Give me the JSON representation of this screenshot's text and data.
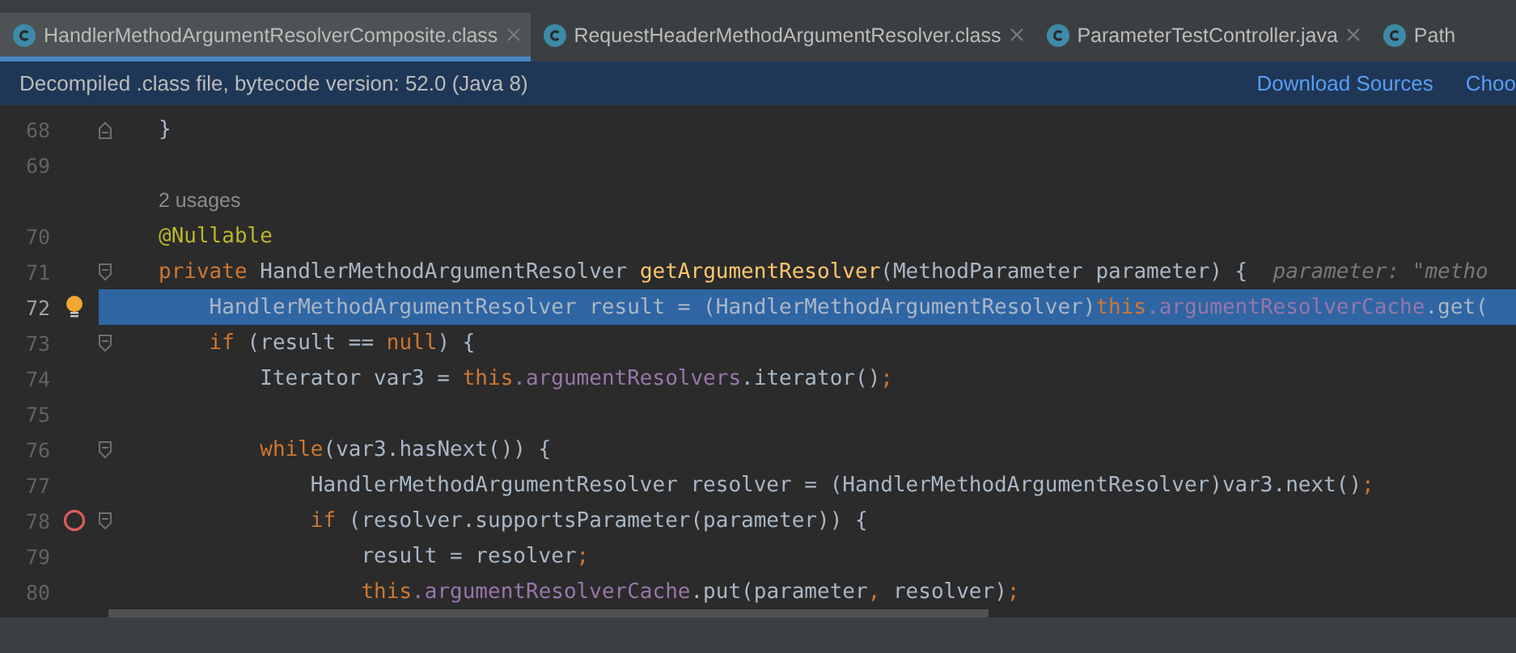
{
  "tabs": [
    {
      "label": "HandlerMethodArgumentResolverComposite.class",
      "selected": true,
      "closable": true
    },
    {
      "label": "RequestHeaderMethodArgumentResolver.class",
      "selected": false,
      "closable": true
    },
    {
      "label": "ParameterTestController.java",
      "selected": false,
      "closable": true
    },
    {
      "label": "Path",
      "selected": false,
      "closable": false
    }
  ],
  "banner": {
    "message": "Decompiled .class file, bytecode version: 52.0 (Java 8)",
    "links": [
      "Download Sources",
      "Choo"
    ]
  },
  "editor": {
    "lines": [
      {
        "kind": "code",
        "number": "68",
        "selected": false,
        "fold": {
          "kind": "end"
        },
        "tokens": [
          {
            "kind": "plain",
            "s": "}"
          }
        ]
      },
      {
        "kind": "code",
        "number": "69",
        "selected": false
      },
      {
        "kind": "usages",
        "text": "2 usages"
      },
      {
        "kind": "code",
        "number": "70",
        "selected": false,
        "tokens": [
          {
            "kind": "annotation",
            "s": "@Nullable"
          }
        ]
      },
      {
        "kind": "code",
        "number": "71",
        "selected": false,
        "fold": {
          "kind": "start"
        },
        "tokens": [
          {
            "kind": "kw",
            "s": "private "
          },
          {
            "kind": "plain",
            "s": "HandlerMethodArgumentResolver "
          },
          {
            "kind": "method",
            "s": "getArgumentResolver"
          },
          {
            "kind": "plain",
            "s": "(MethodParameter parameter) {  "
          },
          {
            "kind": "hint",
            "s": "parameter: \"metho"
          }
        ]
      },
      {
        "kind": "code",
        "number": "72",
        "selected": true,
        "gutter_icon": {
          "kind": "bulb"
        },
        "tokens": [
          {
            "kind": "plain",
            "s": "    HandlerMethodArgumentResolver result = (HandlerMethodArgumentResolver)"
          },
          {
            "kind": "kw",
            "s": "this"
          },
          {
            "kind": "field",
            "s": ".argumentResolverCache"
          },
          {
            "kind": "plain",
            "s": ".get("
          }
        ]
      },
      {
        "kind": "code",
        "number": "73",
        "selected": false,
        "fold": {
          "kind": "start"
        },
        "tokens": [
          {
            "kind": "kw",
            "s": "    if "
          },
          {
            "kind": "plain",
            "s": "(result == "
          },
          {
            "kind": "kw",
            "s": "null"
          },
          {
            "kind": "plain",
            "s": ") {"
          }
        ]
      },
      {
        "kind": "code",
        "number": "74",
        "selected": false,
        "tokens": [
          {
            "kind": "plain",
            "s": "        Iterator var3 = "
          },
          {
            "kind": "kw",
            "s": "this"
          },
          {
            "kind": "field",
            "s": ".argumentResolvers"
          },
          {
            "kind": "plain",
            "s": ".iterator()"
          },
          {
            "kind": "kw",
            "s": ";"
          }
        ]
      },
      {
        "kind": "code",
        "number": "75",
        "selected": false
      },
      {
        "kind": "code",
        "number": "76",
        "selected": false,
        "fold": {
          "kind": "start"
        },
        "tokens": [
          {
            "kind": "kw",
            "s": "        while"
          },
          {
            "kind": "plain",
            "s": "(var3.hasNext()) {"
          }
        ]
      },
      {
        "kind": "code",
        "number": "77",
        "selected": false,
        "tokens": [
          {
            "kind": "plain",
            "s": "            HandlerMethodArgumentResolver resolver = (HandlerMethodArgumentResolver)var3.next()"
          },
          {
            "kind": "kw",
            "s": ";"
          }
        ]
      },
      {
        "kind": "code",
        "number": "78",
        "selected": false,
        "gutter_icon": {
          "kind": "breakpoint"
        },
        "fold": {
          "kind": "start"
        },
        "tokens": [
          {
            "kind": "kw",
            "s": "            if "
          },
          {
            "kind": "plain",
            "s": "(resolver.supportsParameter(parameter)) {"
          }
        ]
      },
      {
        "kind": "code",
        "number": "79",
        "selected": false,
        "tokens": [
          {
            "kind": "plain",
            "s": "                result = resolver"
          },
          {
            "kind": "kw",
            "s": ";"
          }
        ]
      },
      {
        "kind": "code",
        "number": "80",
        "selected": false,
        "tokens": [
          {
            "kind": "kw",
            "s": "                this"
          },
          {
            "kind": "field",
            "s": ".argumentResolverCache"
          },
          {
            "kind": "plain",
            "s": ".put(parameter"
          },
          {
            "kind": "kw",
            "s": ", "
          },
          {
            "kind": "plain",
            "s": "resolver)"
          },
          {
            "kind": "kw",
            "s": ";"
          }
        ]
      }
    ]
  }
}
